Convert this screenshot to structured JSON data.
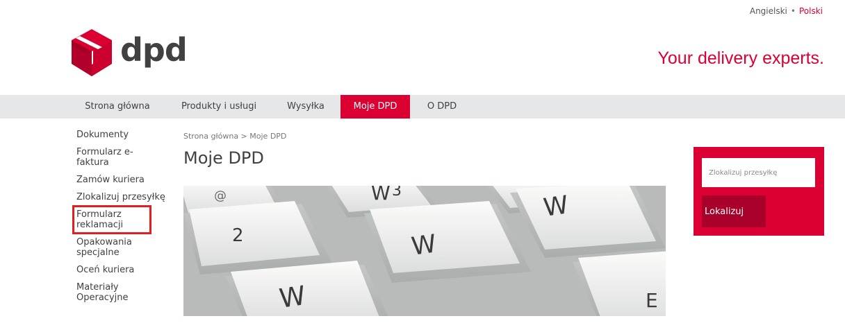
{
  "language": {
    "english": "Angielski",
    "polish": "Polski",
    "separator": "•"
  },
  "brand": {
    "logo_text": "dpd",
    "tagline": "Your delivery experts.",
    "accent_color": "#dc0032"
  },
  "nav": {
    "items": [
      {
        "label": "Strona główna"
      },
      {
        "label": "Produkty i usługi"
      },
      {
        "label": "Wysyłka"
      },
      {
        "label": "Moje DPD"
      },
      {
        "label": "O DPD"
      }
    ],
    "active": "Moje DPD"
  },
  "sidebar": {
    "items": [
      {
        "label": "Dokumenty"
      },
      {
        "label": "Formularz e-faktura"
      },
      {
        "label": "Zamów kuriera"
      },
      {
        "label": "Zlokalizuj przesyłkę"
      },
      {
        "label": "Formularz reklamacji"
      },
      {
        "label": "Opakowania specjalne"
      },
      {
        "label": "Oceń kuriera"
      },
      {
        "label": "Materiały Operacyjne"
      }
    ]
  },
  "main": {
    "breadcrumb": "Strona główna > Moje DPD",
    "title": "Moje DPD"
  },
  "hero": {
    "keys": [
      "2",
      "W",
      "W",
      "W",
      "W",
      "E",
      "3",
      "@"
    ]
  },
  "tracking": {
    "placeholder": "Zlokalizuj przesyłkę",
    "button_label": "Lokalizuj"
  }
}
